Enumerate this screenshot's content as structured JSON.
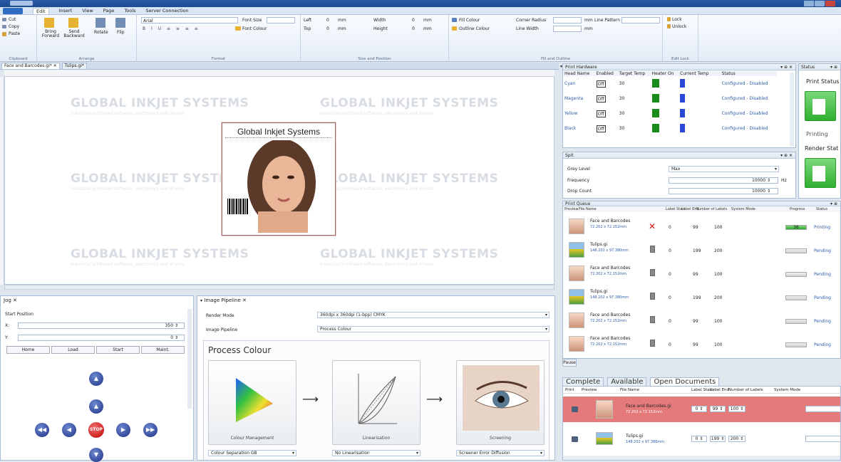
{
  "ribbon": {
    "tabs": [
      "Edit",
      "Insert",
      "View",
      "Page",
      "Tools",
      "Server Connection"
    ],
    "clipboard": {
      "cut": "Cut",
      "copy": "Copy",
      "paste": "Paste",
      "label": "Clipboard"
    },
    "arrange": {
      "bring": "Bring Forward",
      "send": "Send Backward",
      "rotate": "Rotate",
      "flip": "Flip",
      "label": "Arrange"
    },
    "format": {
      "font": "Arial",
      "font_size_label": "Font Size",
      "font_colour": "Font Colour",
      "label": "Format"
    },
    "size_position": {
      "left": "Left",
      "top": "Top",
      "width": "Width",
      "height": "Height",
      "value": "0",
      "unit": "mm",
      "label": "Size and Position"
    },
    "fill_outline": {
      "fill_colour": "Fill Colour",
      "outline_colour": "Outline Colour",
      "corner_radius": "Corner Radius",
      "line_width": "Line Width",
      "line_pattern": "Line Pattern",
      "unit": "mm",
      "label": "Fill and Outline"
    },
    "edit_lock": {
      "lock": "Lock",
      "unlock": "Unlock",
      "label": "Edit Lock"
    }
  },
  "doc_tabs": [
    {
      "label": "Face and Barcodes.gi*"
    },
    {
      "label": "Tulips.gi*"
    }
  ],
  "canvas": {
    "watermark": "GLOBAL INKJET SYSTEMS",
    "watermark_sub": "Industrial printhead software, electronics and drivers",
    "card_title": "Global Inkjet Systems"
  },
  "print_hardware": {
    "title": "Print Hardware",
    "columns": [
      "Head Name",
      "Enabled",
      "Target Temp",
      "Heater On",
      "Current Temp",
      "Status"
    ],
    "rows": [
      {
        "name": "Cyan",
        "enabled": "Off",
        "target": "30",
        "status": "Configured - Disabled"
      },
      {
        "name": "Magenta",
        "enabled": "Off",
        "target": "30",
        "status": "Configured - Disabled"
      },
      {
        "name": "Yellow",
        "enabled": "Off",
        "target": "30",
        "status": "Configured - Disabled"
      },
      {
        "name": "Black",
        "enabled": "Off",
        "target": "30",
        "status": "Configured - Disabled"
      }
    ]
  },
  "spit": {
    "title": "Spit",
    "grey_level_label": "Grey Level",
    "grey_level": "Max",
    "frequency_label": "Frequency",
    "frequency": "10000",
    "frequency_unit": "Hz",
    "drop_count_label": "Drop Count",
    "drop_count": "10000"
  },
  "status_panel": {
    "title": "Status",
    "print_status": "Print Status",
    "printing": "Printing",
    "render_status": "Render Stat"
  },
  "print_queue": {
    "title": "Print Queue",
    "columns": [
      "Preview",
      "File Name",
      "Label Start",
      "Label End",
      "Number of Labels",
      "System Mode",
      "Progress",
      "Status"
    ],
    "rows": [
      {
        "name": "Face and Barcodes",
        "size": "72.202 x 72.152mm",
        "start": "0",
        "end": "99",
        "count": "100",
        "progress": "36",
        "status": "Printing",
        "thumb": "face",
        "mark": "x"
      },
      {
        "name": "Tulips.gi",
        "size": "148.202 x 97.380mm",
        "start": "0",
        "end": "199",
        "count": "200",
        "progress": "",
        "status": "Pending",
        "thumb": "tulip",
        "mark": "doc"
      },
      {
        "name": "Face and Barcodes",
        "size": "72.202 x 72.152mm",
        "start": "0",
        "end": "99",
        "count": "100",
        "progress": "",
        "status": "Pending",
        "thumb": "face",
        "mark": "doc"
      },
      {
        "name": "Tulips.gi",
        "size": "148.202 x 97.380mm",
        "start": "0",
        "end": "199",
        "count": "200",
        "progress": "",
        "status": "Pending",
        "thumb": "tulip",
        "mark": "doc"
      },
      {
        "name": "Face and Barcodes",
        "size": "72.202 x 72.152mm",
        "start": "0",
        "end": "99",
        "count": "100",
        "progress": "",
        "status": "Pending",
        "thumb": "face",
        "mark": "doc"
      },
      {
        "name": "Face and Barcodes",
        "size": "72.202 x 72.152mm",
        "start": "0",
        "end": "99",
        "count": "100",
        "progress": "",
        "status": "Pending",
        "thumb": "face",
        "mark": "doc"
      }
    ],
    "pause_label": "Pause"
  },
  "bottom_tabs": [
    "Complete",
    "Available",
    "Open Documents"
  ],
  "open_docs": {
    "columns": [
      "Print",
      "Preview",
      "File Name",
      "Label Start",
      "Label End",
      "Number of Labels",
      "System Mode"
    ],
    "rows": [
      {
        "name": "Face and Barcodes.gi",
        "size": "72.202 x 72.152mm",
        "start": "0",
        "end": "99",
        "count": "100"
      },
      {
        "name": "Tulips.gi",
        "size": "148.202 x 97.380mm",
        "start": "0",
        "end": "199",
        "count": "200"
      }
    ]
  },
  "jog": {
    "title": "Jog",
    "start_position": "Start Position",
    "x_label": "X:",
    "x_value": "350",
    "y_label": "Y:",
    "y_value": "0",
    "buttons": [
      "Home",
      "Load",
      "Start",
      "Maint."
    ],
    "stop": "STOP"
  },
  "pipeline": {
    "title": "Image Pipeline",
    "render_mode_label": "Render Mode",
    "render_mode": "360dpi x 360dpi (1-bpp) CMYK",
    "pipeline_label": "Image Pipeline",
    "pipeline": "Process Colour",
    "heading": "Process Colour",
    "stages": [
      {
        "label": "Colour Management",
        "select": "Colour Separation GB"
      },
      {
        "label": "Linearisation",
        "select": "No Linearisation"
      },
      {
        "label": "Screening",
        "select": "Screener Error Diffusion"
      }
    ]
  }
}
